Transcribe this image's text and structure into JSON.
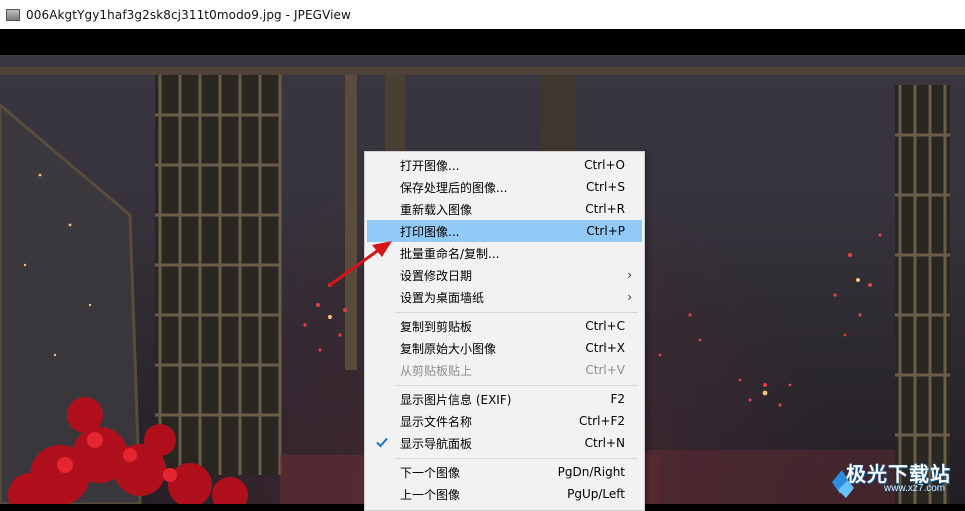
{
  "window": {
    "title": "006AkgtYgy1haf3g2sk8cj311t0modo9.jpg - JPEGView"
  },
  "menu": {
    "items": [
      {
        "label": "打开图像...",
        "shortcut": "Ctrl+O"
      },
      {
        "label": "保存处理后的图像...",
        "shortcut": "Ctrl+S"
      },
      {
        "label": "重新载入图像",
        "shortcut": "Ctrl+R"
      },
      {
        "label": "打印图像...",
        "shortcut": "Ctrl+P",
        "highlighted": true
      },
      {
        "label": "批量重命名/复制...",
        "shortcut": ""
      },
      {
        "label": "设置修改日期",
        "submenu": true
      },
      {
        "label": "设置为桌面墙纸",
        "submenu": true
      },
      {
        "label": "复制到剪贴板",
        "shortcut": "Ctrl+C"
      },
      {
        "label": "复制原始大小图像",
        "shortcut": "Ctrl+X"
      },
      {
        "label": "从剪贴板贴上",
        "shortcut": "Ctrl+V",
        "disabled": true
      },
      {
        "label": "显示图片信息 (EXIF)",
        "shortcut": "F2"
      },
      {
        "label": "显示文件名称",
        "shortcut": "Ctrl+F2"
      },
      {
        "label": "显示导航面板",
        "shortcut": "Ctrl+N",
        "checked": true
      },
      {
        "label": "下一个图像",
        "shortcut": "PgDn/Right"
      },
      {
        "label": "上一个图像",
        "shortcut": "PgUp/Left"
      }
    ],
    "submenu_arrow": "›",
    "highlight_color": "#91c9f7",
    "check_color": "#1a73c9"
  },
  "annotation": {
    "arrow_color": "#d8141a",
    "icon": "red-pointer-arrow"
  },
  "watermark": {
    "text": "极光下载站",
    "url": "www.xz7.com"
  }
}
